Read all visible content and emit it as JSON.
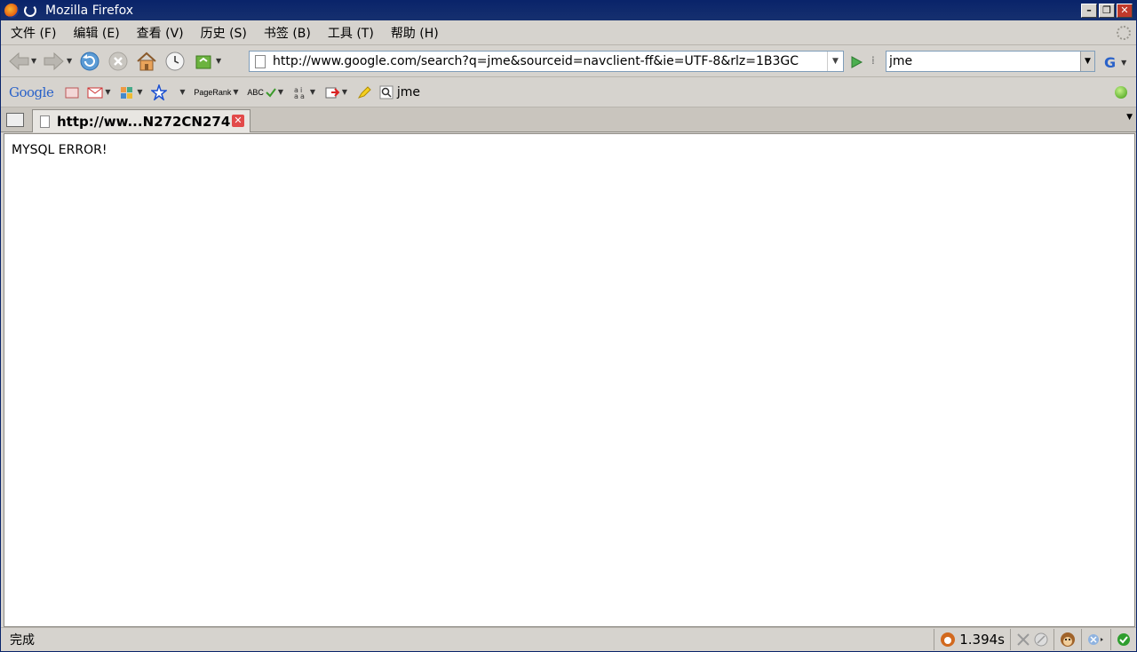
{
  "window": {
    "title": "Mozilla Firefox",
    "controls": [
      "minimize",
      "maximize",
      "close"
    ]
  },
  "menubar": {
    "items": [
      {
        "label": "文件 (F)"
      },
      {
        "label": "编辑 (E)"
      },
      {
        "label": "查看 (V)"
      },
      {
        "label": "历史 (S)"
      },
      {
        "label": "书签 (B)"
      },
      {
        "label": "工具 (T)"
      },
      {
        "label": "帮助 (H)"
      }
    ]
  },
  "navigation": {
    "url": "http://www.google.com/search?q=jme&sourceid=navclient-ff&ie=UTF-8&rlz=1B3GC",
    "search_value": "jme",
    "search_engine_icon": "G"
  },
  "google_toolbar": {
    "logo": "Google",
    "pagerank_label": "PageRank",
    "abc_label": "ABC",
    "search_term": "jme"
  },
  "tabs": [
    {
      "label": "http://ww...N272CN274",
      "active": true
    }
  ],
  "page": {
    "message": "MYSQL ERROR!"
  },
  "statusbar": {
    "status_text": "完成",
    "load_time": "1.394s"
  },
  "colors": {
    "titlebar": "#0a246a",
    "chrome": "#d6d3ce",
    "accent_green": "#3c9a12",
    "close_red": "#e24a4a"
  }
}
